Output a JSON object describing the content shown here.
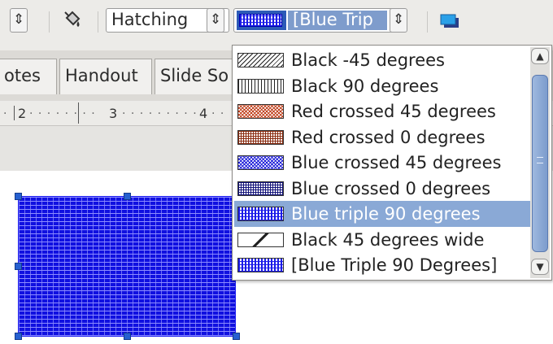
{
  "toolbar": {
    "left_spin_icon": "spin-updown-icon",
    "fill_icon": "paint-bucket-icon",
    "area_style_value": "Hatching",
    "fill_value": "[Blue Trip",
    "shadow_icon": "shadow-icon"
  },
  "tabs": [
    {
      "label": "otes"
    },
    {
      "label": "Handout"
    },
    {
      "label": "Slide So"
    }
  ],
  "ruler": {
    "mark2": "2",
    "mark3": "3",
    "mark4": "4"
  },
  "dropdown": {
    "items": [
      {
        "label": "Black -45 degrees",
        "swatch": "black-45",
        "selected": false
      },
      {
        "label": "Black 90 degrees",
        "swatch": "black-90",
        "selected": false
      },
      {
        "label": "Red crossed 45 degrees",
        "swatch": "red-crossed-45",
        "selected": false
      },
      {
        "label": "Red crossed 0 degrees",
        "swatch": "red-crossed-0",
        "selected": false
      },
      {
        "label": "Blue crossed 45 degrees",
        "swatch": "blue-crossed-45",
        "selected": false
      },
      {
        "label": "Blue crossed 0 degrees",
        "swatch": "blue-crossed-0",
        "selected": false
      },
      {
        "label": "Blue triple 90 degrees",
        "swatch": "blue-triple-90",
        "selected": true
      },
      {
        "label": "Black 45 degrees wide",
        "swatch": "black-45-wide",
        "selected": false
      },
      {
        "label": "[Blue Triple 90 Degrees]",
        "swatch": "blue-triple-90",
        "selected": false
      }
    ]
  },
  "colors": {
    "accent_selected": "#8aa9d6",
    "shape_fill": "#1010e0",
    "handle": "#2660d0"
  }
}
